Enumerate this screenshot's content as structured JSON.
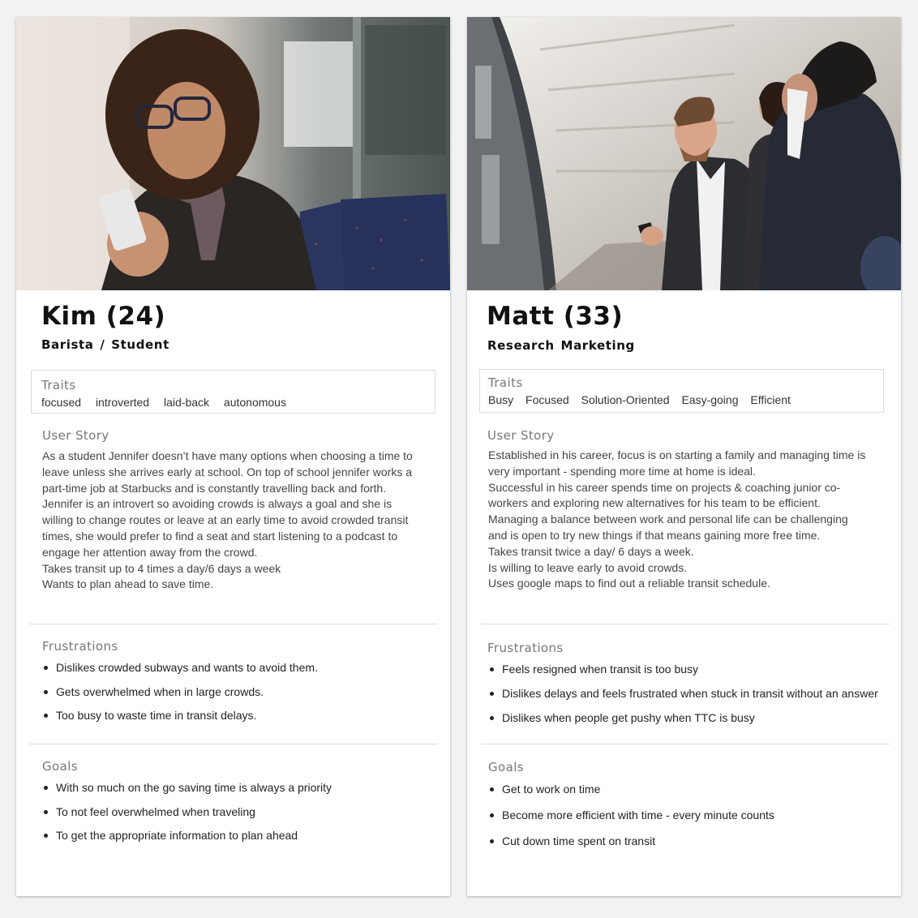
{
  "personas": [
    {
      "name": "Kim (24)",
      "role": "Barista  /  Student",
      "traits_title": "Traits",
      "traits": [
        "focused",
        "introverted",
        "laid-back",
        "autonomous"
      ],
      "story_title": "User Story",
      "story_lines": [
        "As a student Jennifer doesn’t have many options when choosing a time to",
        "leave unless she arrives early at school. On top of school jennifer works a",
        "part-time job at Starbucks and is constantly travelling back and forth.",
        "Jennifer is an introvert so avoiding crowds is always a goal and she is",
        "willing to change routes or leave at an early time to avoid crowded transit",
        "times, she would prefer to find a seat and start listening to a podcast to",
        "engage her attention away from the crowd.",
        "Takes transit up to 4 times a day/6 days a week",
        "Wants to plan ahead to save time."
      ],
      "frustrations_title": "Frustrations",
      "frustrations": [
        "Dislikes crowded subways and wants to avoid them.",
        "Gets overwhelmed when in large crowds.",
        "Too busy to waste time in transit delays."
      ],
      "goals_title": "Goals",
      "goals": [
        "With so much on the go saving time is always a priority",
        "To not feel overwhelmed when traveling",
        "To get the appropriate information to plan ahead"
      ]
    },
    {
      "name": "Matt (33)",
      "role": "Research Marketing",
      "traits_title": "Traits",
      "traits": [
        "Busy",
        "Focused",
        "Solution-Oriented",
        "Easy-going",
        "Efficient"
      ],
      "story_title": "User Story",
      "story_lines": [
        "Established in his career, focus is on starting a family and managing time is",
        "very important - spending more time at home is ideal.",
        "Successful in his career spends time on projects & coaching junior co-",
        "workers and exploring new alternatives for his team to be efficient.",
        "Managing a balance between work and personal life can be challenging",
        "and is open to try new things if that means gaining more free time.",
        "Takes transit twice a day/ 6 days a week.",
        "Is willing to leave early to avoid crowds.",
        "Uses google maps to find out a reliable transit schedule."
      ],
      "frustrations_title": "Frustrations",
      "frustrations": [
        "Feels resigned when transit is too busy",
        "Dislikes delays and feels frustrated when stuck in transit without an answer",
        "Dislikes when people get pushy when TTC is busy"
      ],
      "goals_title": "Goals",
      "goals": [
        "Get to work on time",
        "Become more efficient with time - every minute counts",
        "Cut down time spent on transit"
      ]
    }
  ]
}
